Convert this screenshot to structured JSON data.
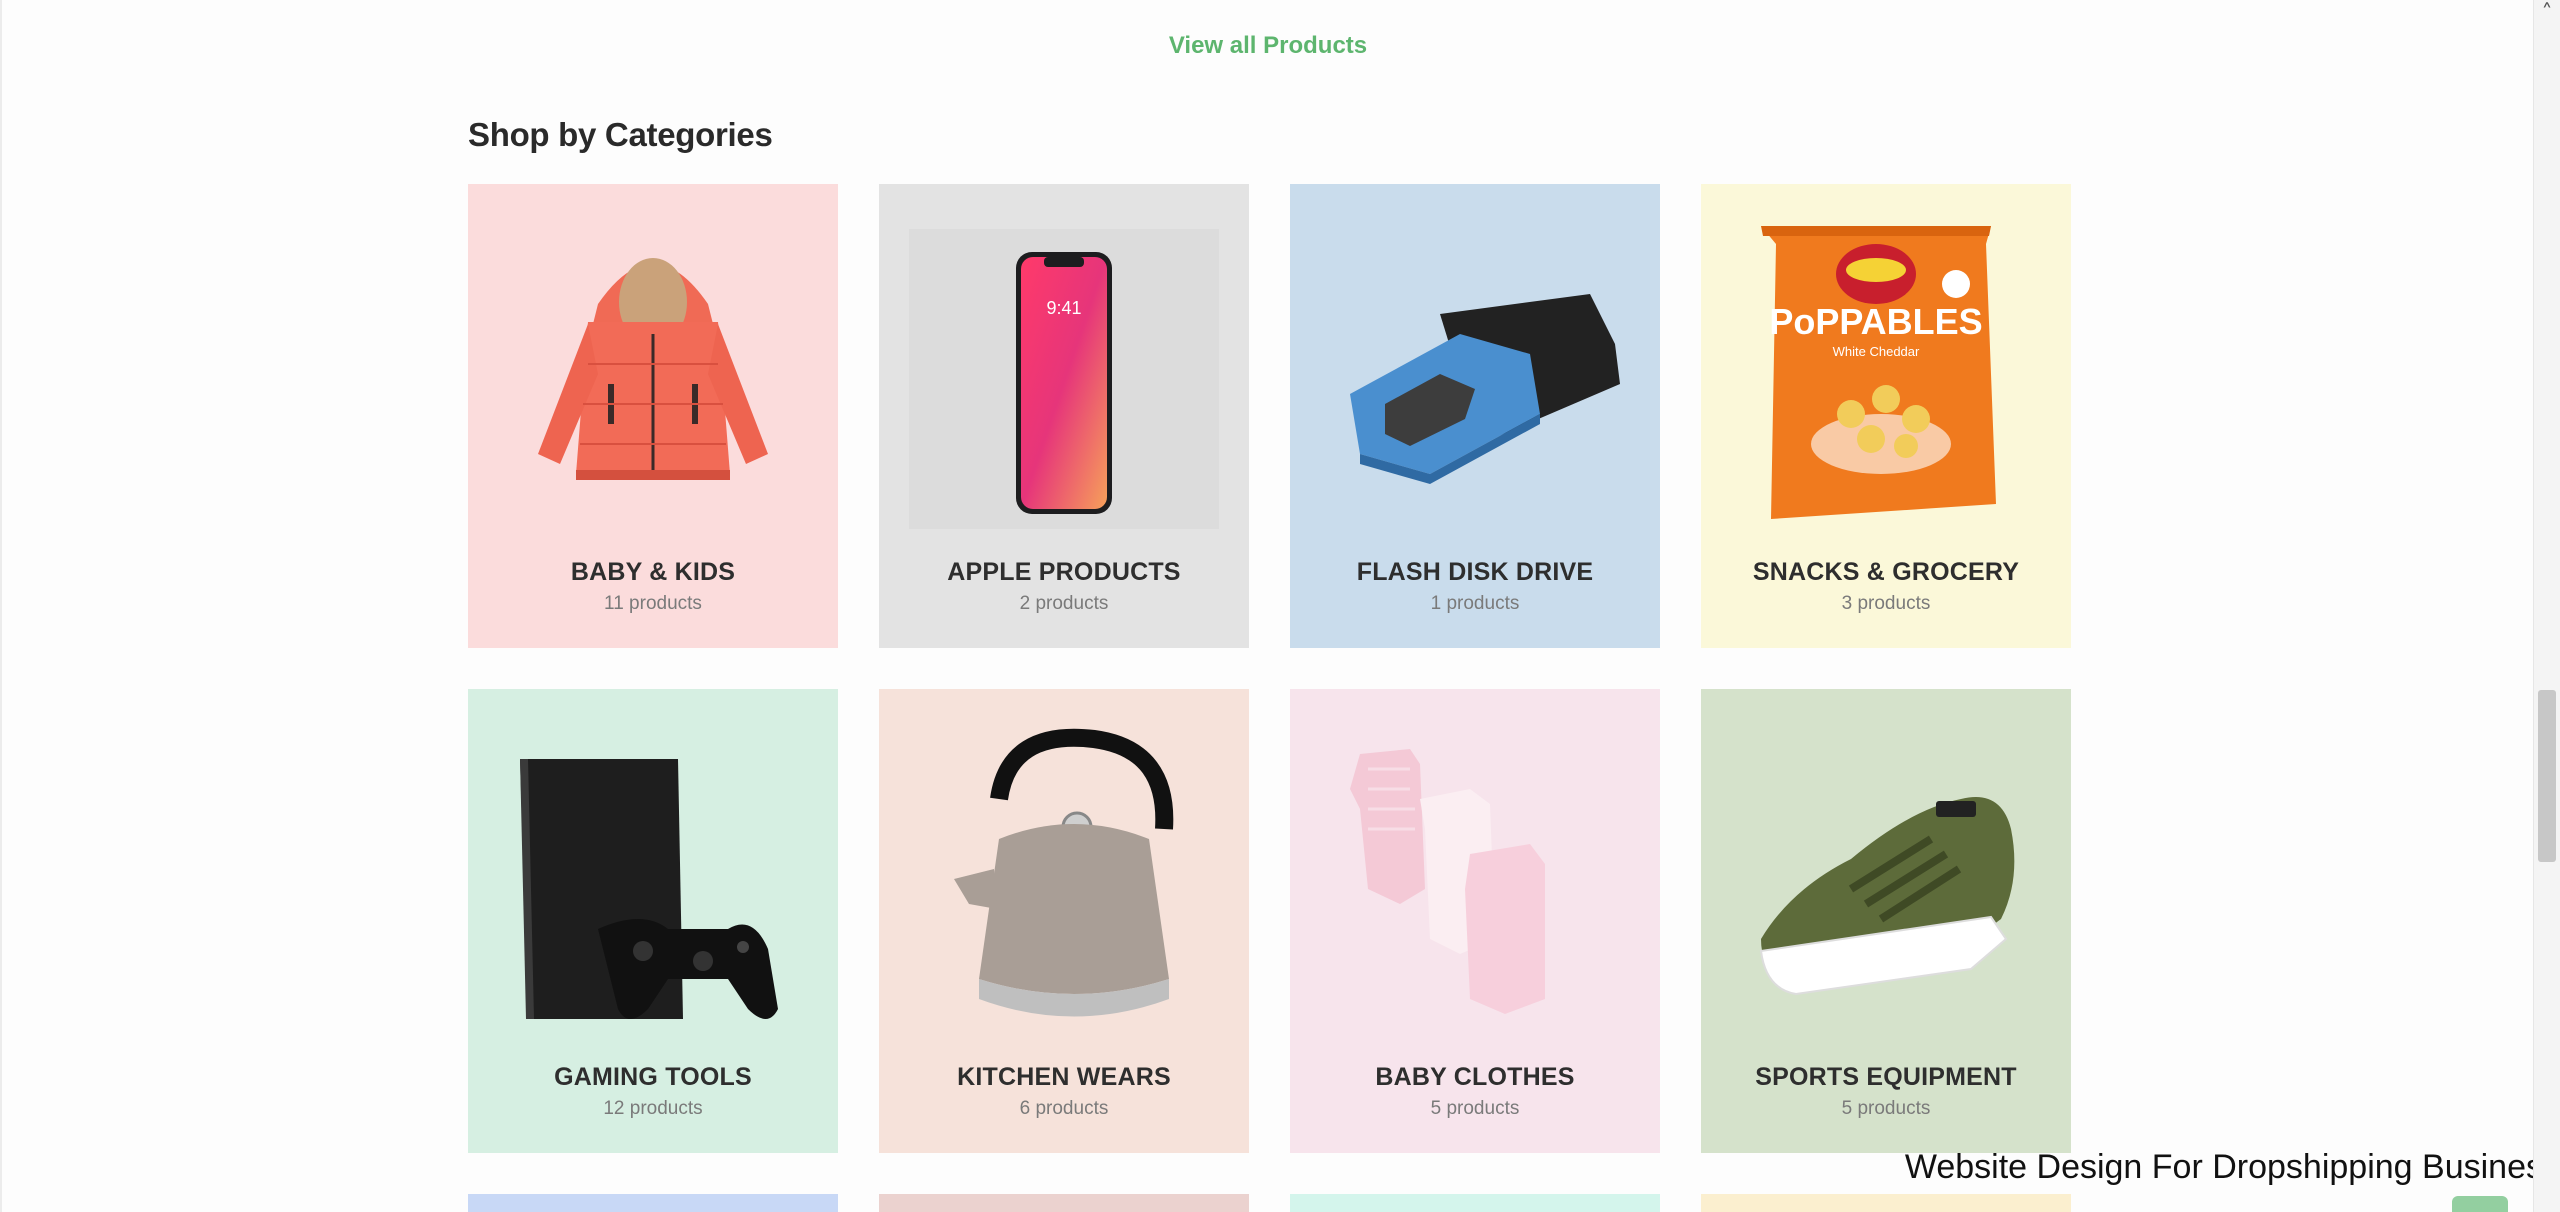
{
  "link": {
    "view_all": "View all Products"
  },
  "section": {
    "title": "Shop by Categories"
  },
  "categories": [
    {
      "name": "BABY & KIDS",
      "count": "11 products",
      "bg": "#fbdcdc",
      "icon": "red-jacket-icon"
    },
    {
      "name": "APPLE PRODUCTS",
      "count": "2 products",
      "bg": "#e3e3e3",
      "icon": "smartphone-icon"
    },
    {
      "name": "FLASH DISK DRIVE",
      "count": "1 products",
      "bg": "#c9dcec",
      "icon": "usb-drive-icon"
    },
    {
      "name": "SNACKS & GROCERY",
      "count": "3 products",
      "bg": "#fbf8d9",
      "icon": "chips-bag-icon"
    },
    {
      "name": "GAMING TOOLS",
      "count": "12 products",
      "bg": "#d6efe2",
      "icon": "game-console-icon"
    },
    {
      "name": "KITCHEN WEARS",
      "count": "6 products",
      "bg": "#f6e2da",
      "icon": "kettle-icon"
    },
    {
      "name": "BABY CLOTHES",
      "count": "5 products",
      "bg": "#f7e4ec",
      "icon": "baby-bodysuits-icon"
    },
    {
      "name": "SPORTS EQUIPMENT",
      "count": "5 products",
      "bg": "#d5e2cb",
      "icon": "sneaker-icon"
    }
  ],
  "next_row_colors": [
    "#c8d8f6",
    "#ebd2cf",
    "#d4f5ec",
    "#fbefcf"
  ],
  "watermark": "Website Design For Dropshipping Business",
  "scrollbar": {
    "up_glyph": "˄"
  },
  "colors": {
    "accent": "#5db56e"
  }
}
